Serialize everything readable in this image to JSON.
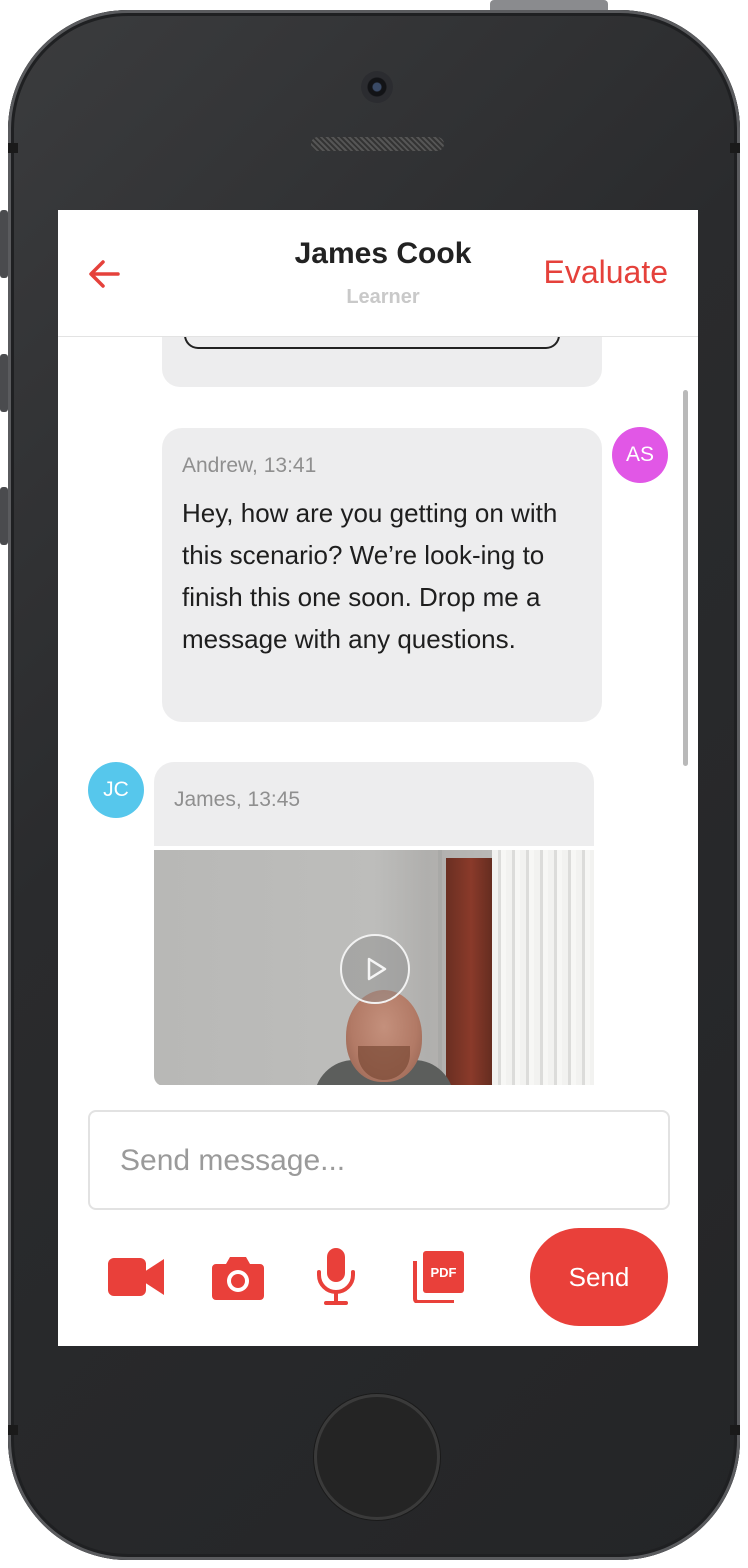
{
  "header": {
    "title": "James Cook",
    "subtitle": "Learner",
    "evaluate_label": "Evaluate",
    "back_icon": "arrow-left-icon"
  },
  "messages": [
    {
      "sender": "Andrew",
      "meta": "Andrew, 13:41",
      "avatar_initials": "AS",
      "avatar_color": "#e157e6",
      "text": "Hey, how are you getting on with this scenario? We’re look-ing to finish this one soon. Drop me a message with any questions."
    },
    {
      "sender": "James",
      "meta": "James, 13:45",
      "avatar_initials": "JC",
      "avatar_color": "#56c7ec",
      "attachment": "video"
    }
  ],
  "composer": {
    "placeholder": "Send message...",
    "send_label": "Send",
    "tools": [
      "video-camera-icon",
      "camera-icon",
      "microphone-icon",
      "pdf-icon"
    ]
  },
  "colors": {
    "accent": "#e9403a",
    "bubble": "#ededee"
  }
}
